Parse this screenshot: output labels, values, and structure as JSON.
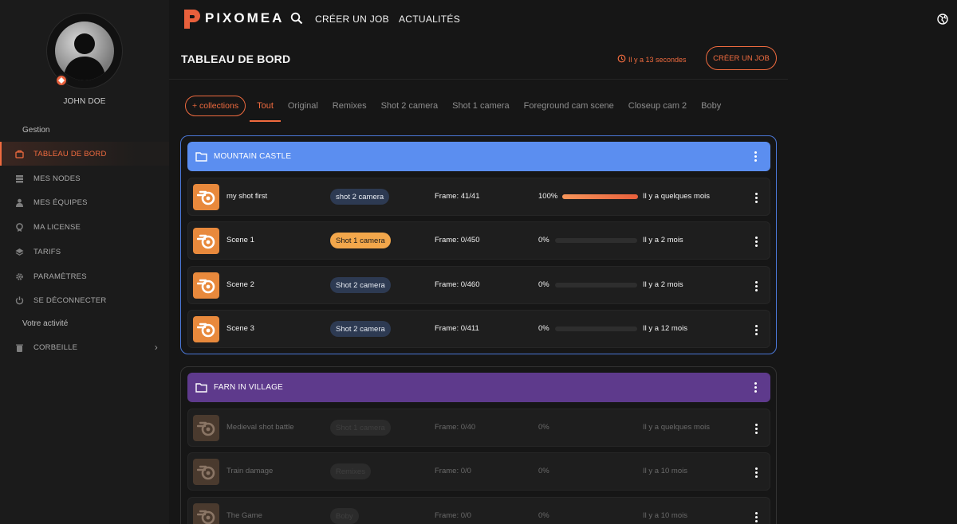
{
  "sidebar": {
    "username": "JOHN DOE",
    "section_gestion": "Gestion",
    "section_activity": "Votre activité",
    "items": [
      {
        "label": "TABLEAU DE BORD",
        "icon": "dashboard-icon",
        "active": true
      },
      {
        "label": "MES NODES",
        "icon": "server-icon"
      },
      {
        "label": "MES ÉQUIPES",
        "icon": "user-icon"
      },
      {
        "label": "MA LICENSE",
        "icon": "license-icon"
      },
      {
        "label": "TARIFS",
        "icon": "layers-icon"
      },
      {
        "label": "PARAMÈTRES",
        "icon": "gear-icon"
      },
      {
        "label": "SE DÉCONNECTER",
        "icon": "power-icon"
      },
      {
        "label": "CORBEILLE",
        "icon": "trash-icon"
      }
    ]
  },
  "topbar": {
    "logo_text": "PIXOMEA",
    "create_job": "CRÉER UN JOB",
    "news": "ACTUALITÉS"
  },
  "header": {
    "title": "TABLEAU DE BORD",
    "last_update": "Il y a 13 secondes",
    "create_button": "CRÉER UN JOB"
  },
  "tabs": {
    "add_label": "+ collections",
    "items": [
      "Tout",
      "Original",
      "Remixes",
      "Shot 2 camera",
      "Shot 1 camera",
      "Foreground cam scene",
      "Closeup cam 2",
      "Boby"
    ],
    "active": "Tout"
  },
  "colors": {
    "accent": "#f06b3f",
    "collection1": "#5b8ef0",
    "collection2": "#5e3a8c"
  },
  "collections": [
    {
      "title": "MOUNTAIN CASTLE",
      "rows": [
        {
          "name": "my shot first",
          "tag": "shot 2 camera",
          "frame": "Frame: 41/41",
          "pct": "100%",
          "progress": 1.0,
          "time": "Il y a quelques mois"
        },
        {
          "name": "Scene 1",
          "tag": "Shot 1 camera",
          "frame": "Frame: 0/450",
          "pct": "0%",
          "progress": 0,
          "time": "Il y a 2 mois"
        },
        {
          "name": "Scene 2",
          "tag": "Shot 2 camera",
          "frame": "Frame: 0/460",
          "pct": "0%",
          "progress": 0,
          "time": "Il y a 2 mois"
        },
        {
          "name": "Scene 3",
          "tag": "Shot 2 camera",
          "frame": "Frame: 0/411",
          "pct": "0%",
          "progress": 0,
          "time": "Il y a 12 mois"
        }
      ]
    },
    {
      "title": "FARN IN VILLAGE",
      "rows": [
        {
          "name": "Medieval shot battle",
          "tag": "Shot 1 camera",
          "frame": "Frame: 0/40",
          "pct": "0%",
          "time": "Il y a quelques mois"
        },
        {
          "name": "Train damage",
          "tag": "Remixes",
          "frame": "Frame: 0/0",
          "pct": "0%",
          "time": "Il y a 10 mois"
        },
        {
          "name": "The Game",
          "tag": "Boby",
          "frame": "Frame: 0/0",
          "pct": "0%",
          "time": "Il y a 10 mois"
        }
      ]
    }
  ]
}
